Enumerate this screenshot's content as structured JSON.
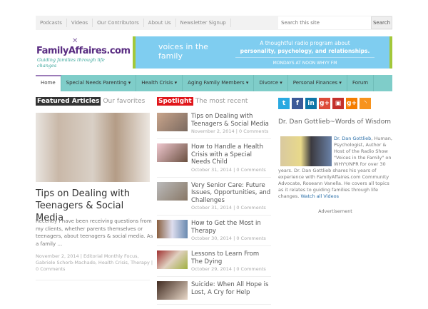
{
  "topbar": {
    "links": [
      "Podcasts",
      "Videos",
      "Our Contributors",
      "About Us",
      "Newsletter Signup"
    ],
    "search_placeholder": "Search this site",
    "search_button": "Search"
  },
  "logo": {
    "title": "FamilyAffaires.com",
    "tagline": "Guiding families through life changes"
  },
  "banner": {
    "brand": "voices in the family",
    "line1": "A thoughtful radio program about",
    "line2": "personality, psychology, and relationships.",
    "line3": "MONDAYS AT NOON  WHYY FM"
  },
  "nav": [
    "Home",
    "Special Needs Parenting ▾",
    "Health Crisis ▾",
    "Aging Family Members ▾",
    "Divorce ▾",
    "Personal Finances ▾",
    "Forum"
  ],
  "featured": {
    "label": "Featured Articles",
    "sub": "Our favorites",
    "title": "Tips on Dealing with Teenagers & Social Media",
    "excerpt": "Recently I have been receiving questions from my clients, whether parents themselves or teenagers, about teenagers & social media.  As a family …",
    "meta": "November 2, 2014 | Editorial Monthly Focus, Gabriele Schorb-Machado, Health Crisis, Therapy | 0 Comments"
  },
  "spotlight": {
    "label": "Spotlight",
    "sub": "The most recent",
    "items": [
      {
        "title": "Tips on Dealing with Teenagers & Social Media",
        "meta": "November 2, 2014 | 0 Comments"
      },
      {
        "title": "How to Handle a Health Crisis with a Special Needs Child",
        "meta": "October 31, 2014 | 0 Comments"
      },
      {
        "title": "Very Senior Care: Future Issues, Opportunities, and Challenges",
        "meta": "October 31, 2014 | 0 Comments"
      },
      {
        "title": "How to Get the Most in Therapy",
        "meta": "October 30, 2014 | 0 Comments"
      },
      {
        "title": "Lessons to Learn From The Dying",
        "meta": "October 29, 2014 | 0 Comments"
      },
      {
        "title": "Suicide: When All Hope is Lost, A Cry for Help",
        "meta": ""
      }
    ]
  },
  "social": [
    {
      "icon": "twitter-icon",
      "glyph": "t",
      "color": "#29a9e1"
    },
    {
      "icon": "facebook-icon",
      "glyph": "f",
      "color": "#3b5998"
    },
    {
      "icon": "linkedin-icon",
      "glyph": "in",
      "color": "#0e76a8"
    },
    {
      "icon": "google-plus-icon",
      "glyph": "g+",
      "color": "#dd4b39"
    },
    {
      "icon": "youtube-icon",
      "glyph": "▣",
      "color": "#c4302b"
    },
    {
      "icon": "google-plus-alt-icon",
      "glyph": "g+",
      "color": "#f57d00"
    },
    {
      "icon": "rss-icon",
      "glyph": "◝",
      "color": "#f7931e"
    }
  ],
  "sidebar": {
    "title": "Dr. Dan Gottlieb~Words of Wisdom",
    "link": "Dr. Dan Gottlieb",
    "text": ", Human, Psychologist, Author & Host of the Radio Show \"Voices in the Family\" on WHYY/NPR for over 30 years. Dr. Dan Gottlieb shares his years of experience with FamilyAffaires.com Community Advocate, Roseann Vanella. He covers all topics as it relates to guiding families through life changes. ",
    "watch": "Watch all Videos",
    "ad": "Advertisement"
  }
}
